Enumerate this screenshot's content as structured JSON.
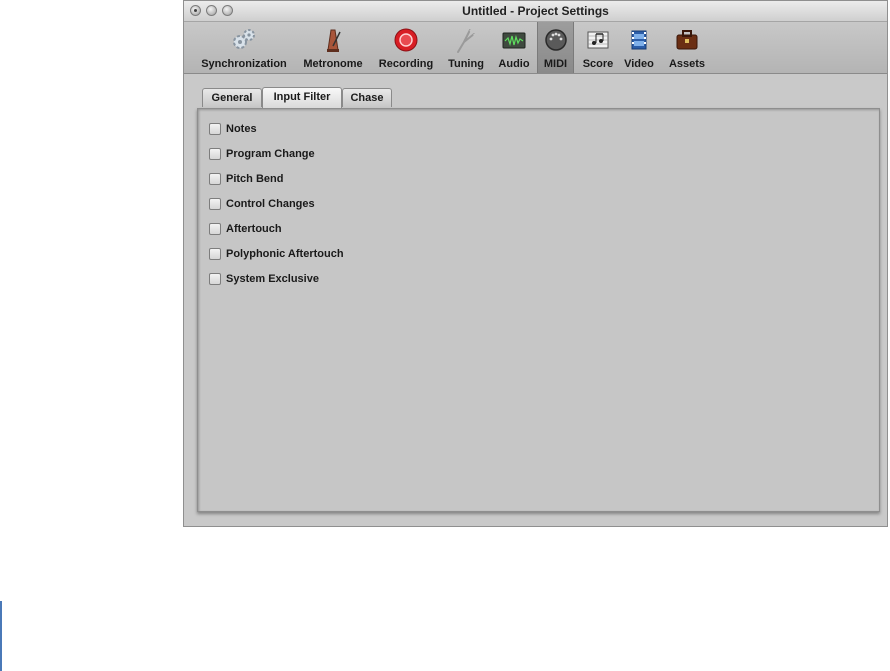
{
  "window": {
    "title": "Untitled - Project Settings"
  },
  "toolbar": {
    "items": [
      {
        "label": "Synchronization",
        "icon": "synchronization-gears-icon"
      },
      {
        "label": "Metronome",
        "icon": "metronome-icon"
      },
      {
        "label": "Recording",
        "icon": "record-icon"
      },
      {
        "label": "Tuning",
        "icon": "tuning-fork-icon"
      },
      {
        "label": "Audio",
        "icon": "audio-waveform-icon"
      },
      {
        "label": "MIDI",
        "icon": "midi-connector-icon",
        "selected": true
      },
      {
        "label": "Score",
        "icon": "score-notes-icon"
      },
      {
        "label": "Video",
        "icon": "video-film-icon"
      },
      {
        "label": "Assets",
        "icon": "briefcase-icon"
      }
    ]
  },
  "tabs": [
    {
      "label": "General"
    },
    {
      "label": "Input Filter",
      "active": true
    },
    {
      "label": "Chase"
    }
  ],
  "filters": [
    {
      "label": "Notes",
      "checked": false
    },
    {
      "label": "Program Change",
      "checked": false
    },
    {
      "label": "Pitch Bend",
      "checked": false
    },
    {
      "label": "Control Changes",
      "checked": false
    },
    {
      "label": "Aftertouch",
      "checked": false
    },
    {
      "label": "Polyphonic Aftertouch",
      "checked": false
    },
    {
      "label": "System Exclusive",
      "checked": false
    }
  ],
  "colors": {
    "recording_red": "#d81d24",
    "window_bg": "#c9c9c9",
    "selected_tab_bg": "#8f8f8f"
  }
}
